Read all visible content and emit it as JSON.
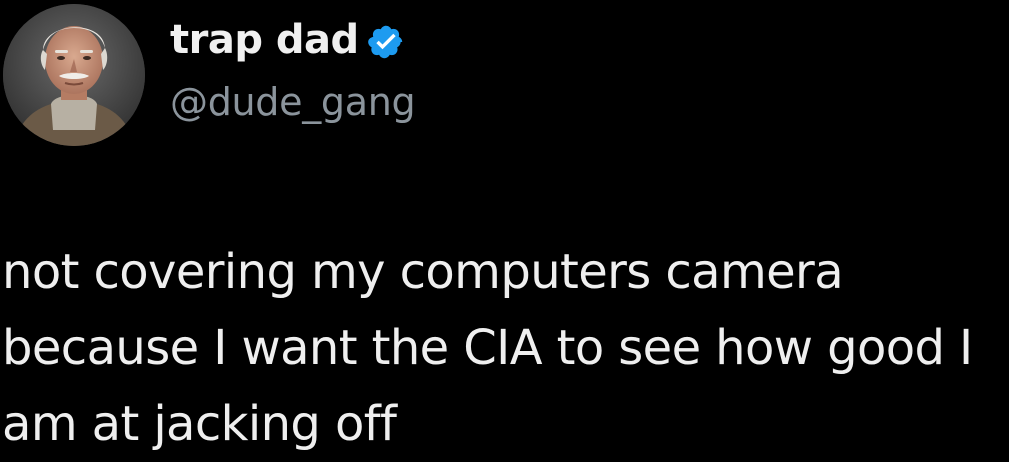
{
  "author": {
    "display_name": "trap dad",
    "handle": "@dude_gang",
    "verified": true,
    "verified_color": "#1d9bf0",
    "avatar": "elderly-man-portrait"
  },
  "tweet": {
    "line_1": "not covering my computers camera",
    "line_2": "because I want the CIA to see how good I",
    "line_3": "am at jacking off"
  },
  "colors": {
    "background": "#000000",
    "text": "#efefef",
    "handle": "#8b949c"
  }
}
